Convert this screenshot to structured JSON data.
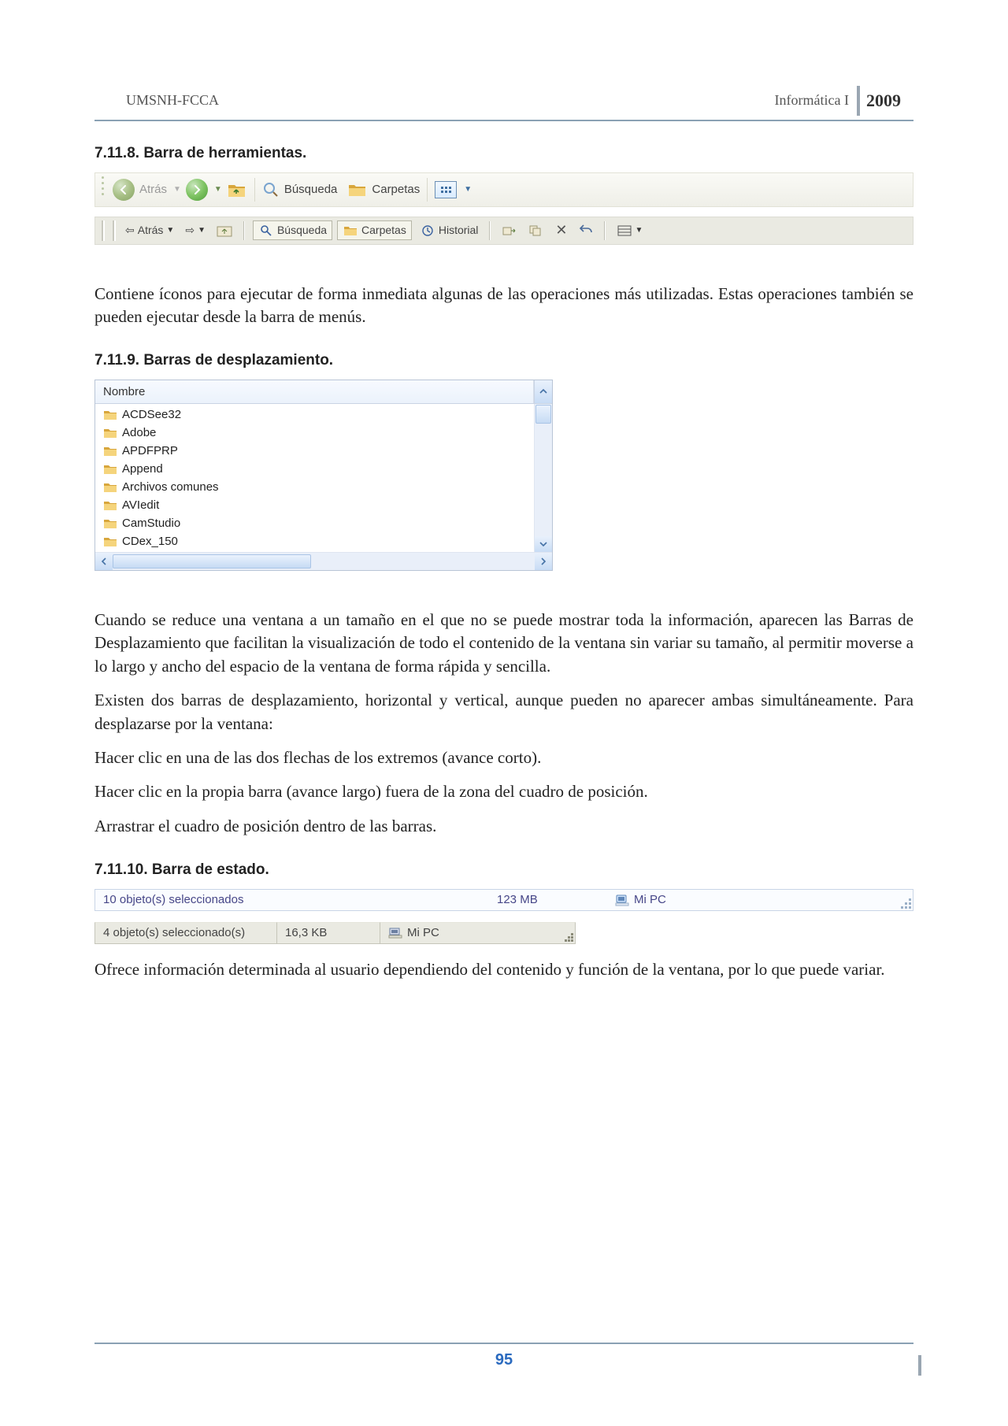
{
  "header": {
    "left": "UMSNH-FCCA",
    "right": "Informática I",
    "year": "2009"
  },
  "footer": {
    "page": "95"
  },
  "section1": {
    "number_title": "7.11.8. Barra de herramientas.",
    "toolbar_xp": {
      "back": "Atrás",
      "search": "Búsqueda",
      "folders": "Carpetas"
    },
    "toolbar_flat": {
      "back": "Atrás",
      "search": "Búsqueda",
      "folders": "Carpetas",
      "history": "Historial"
    },
    "paragraph": "Contiene íconos para ejecutar de forma inmediata algunas de las operaciones más utilizadas. Estas operaciones también se pueden ejecutar desde la barra de menús."
  },
  "section2": {
    "number_title": "7.11.9. Barras de desplazamiento.",
    "list_header": "Nombre",
    "items": [
      "ACDSee32",
      "Adobe",
      "APDFPRP",
      "Append",
      "Archivos comunes",
      "AVIedit",
      "CamStudio",
      "CDex_150"
    ],
    "para1": "Cuando se reduce una ventana a un tamaño en el que no se puede mostrar toda la información, aparecen las Barras de Desplazamiento que facilitan la visualización de todo el contenido de la ventana sin variar su tamaño, al permitir moverse a lo largo y ancho del espacio de la ventana de forma rápida y sencilla.",
    "para2": "Existen dos barras de desplazamiento, horizontal y vertical, aunque pueden no aparecer ambas simultáneamente. Para desplazarse por la ventana:",
    "para3": "Hacer clic en una de las dos flechas de los extremos (avance corto).",
    "para4": "Hacer clic en la propia barra (avance largo) fuera de la zona del cuadro de posición.",
    "para5": "Arrastrar el cuadro de posición dentro de las barras."
  },
  "section3": {
    "number_title": "7.11.10. Barra de estado.",
    "status1": {
      "pane1": "10 objeto(s) seleccionados",
      "pane2": "123 MB",
      "pane3": "Mi PC"
    },
    "status2": {
      "pane1": "4 objeto(s) seleccionado(s)",
      "pane2": "16,3 KB",
      "pane3": "Mi PC"
    },
    "paragraph": "Ofrece información determinada al usuario dependiendo del contenido y función de la ventana, por lo que puede variar."
  }
}
